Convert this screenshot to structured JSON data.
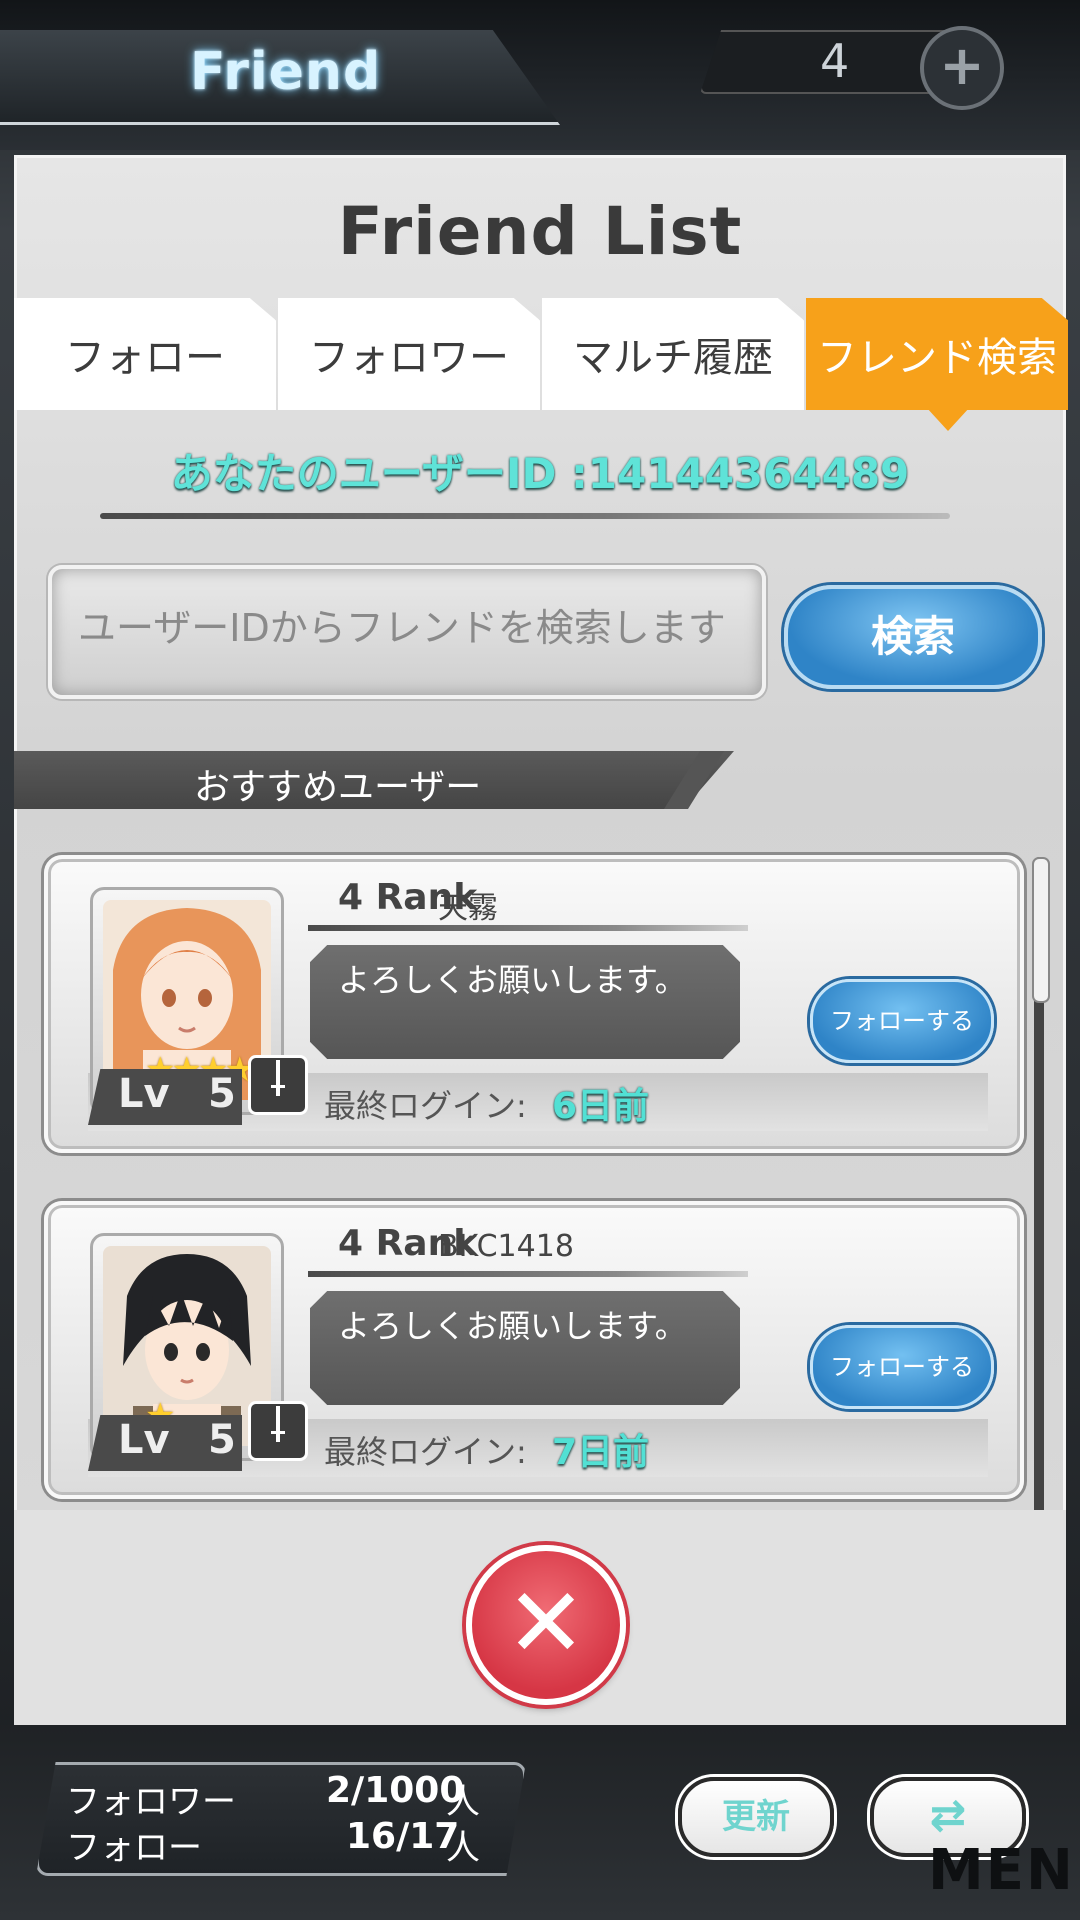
{
  "header": {
    "title": "Friend",
    "counter": "4",
    "plus_icon": "plus-icon"
  },
  "modal": {
    "title": "Friend List",
    "tabs": [
      {
        "label": "フォロー",
        "active": false
      },
      {
        "label": "フォロワー",
        "active": false
      },
      {
        "label": "マルチ履歴",
        "active": false
      },
      {
        "label": "フレンド検索",
        "active": true
      }
    ],
    "user_id": "あなたのユーザーID :14144364489",
    "search": {
      "placeholder": "ユーザーIDからフレンドを検索します",
      "button_label": "検索"
    },
    "section_label": "おすすめユーザー",
    "users": [
      {
        "rank": "4 Rank",
        "name": "天霧",
        "message": "よろしくお願いします。",
        "stars": "★★★★",
        "lv_label": "Lv",
        "lv": "5",
        "follow_label": "フォローする",
        "login_label": "最終ログイン:",
        "login_value": "6日前",
        "avatar_color": "#e8955a"
      },
      {
        "rank": "4 Rank",
        "name": "BKC1418",
        "message": "よろしくお願いします。",
        "stars": "★",
        "lv_label": "Lv",
        "lv": "5",
        "follow_label": "フォローする",
        "login_label": "最終ログイン:",
        "login_value": "7日前",
        "avatar_color": "#222326"
      }
    ],
    "close_icon": "close-icon"
  },
  "footer": {
    "follower_label": "フォロワー",
    "follower_value": "2/1000",
    "follower_unit": "人",
    "follow_label": "フォロー",
    "follow_value": "16/17",
    "follow_unit": "人",
    "refresh_label": "更新",
    "swap_icon": "swap-icon",
    "menu_text": "MENU"
  },
  "colors": {
    "accent_orange": "#f7a11a",
    "button_blue": "#2f84c7",
    "cyan_text": "#5fe3d8",
    "close_red": "#d63645"
  }
}
